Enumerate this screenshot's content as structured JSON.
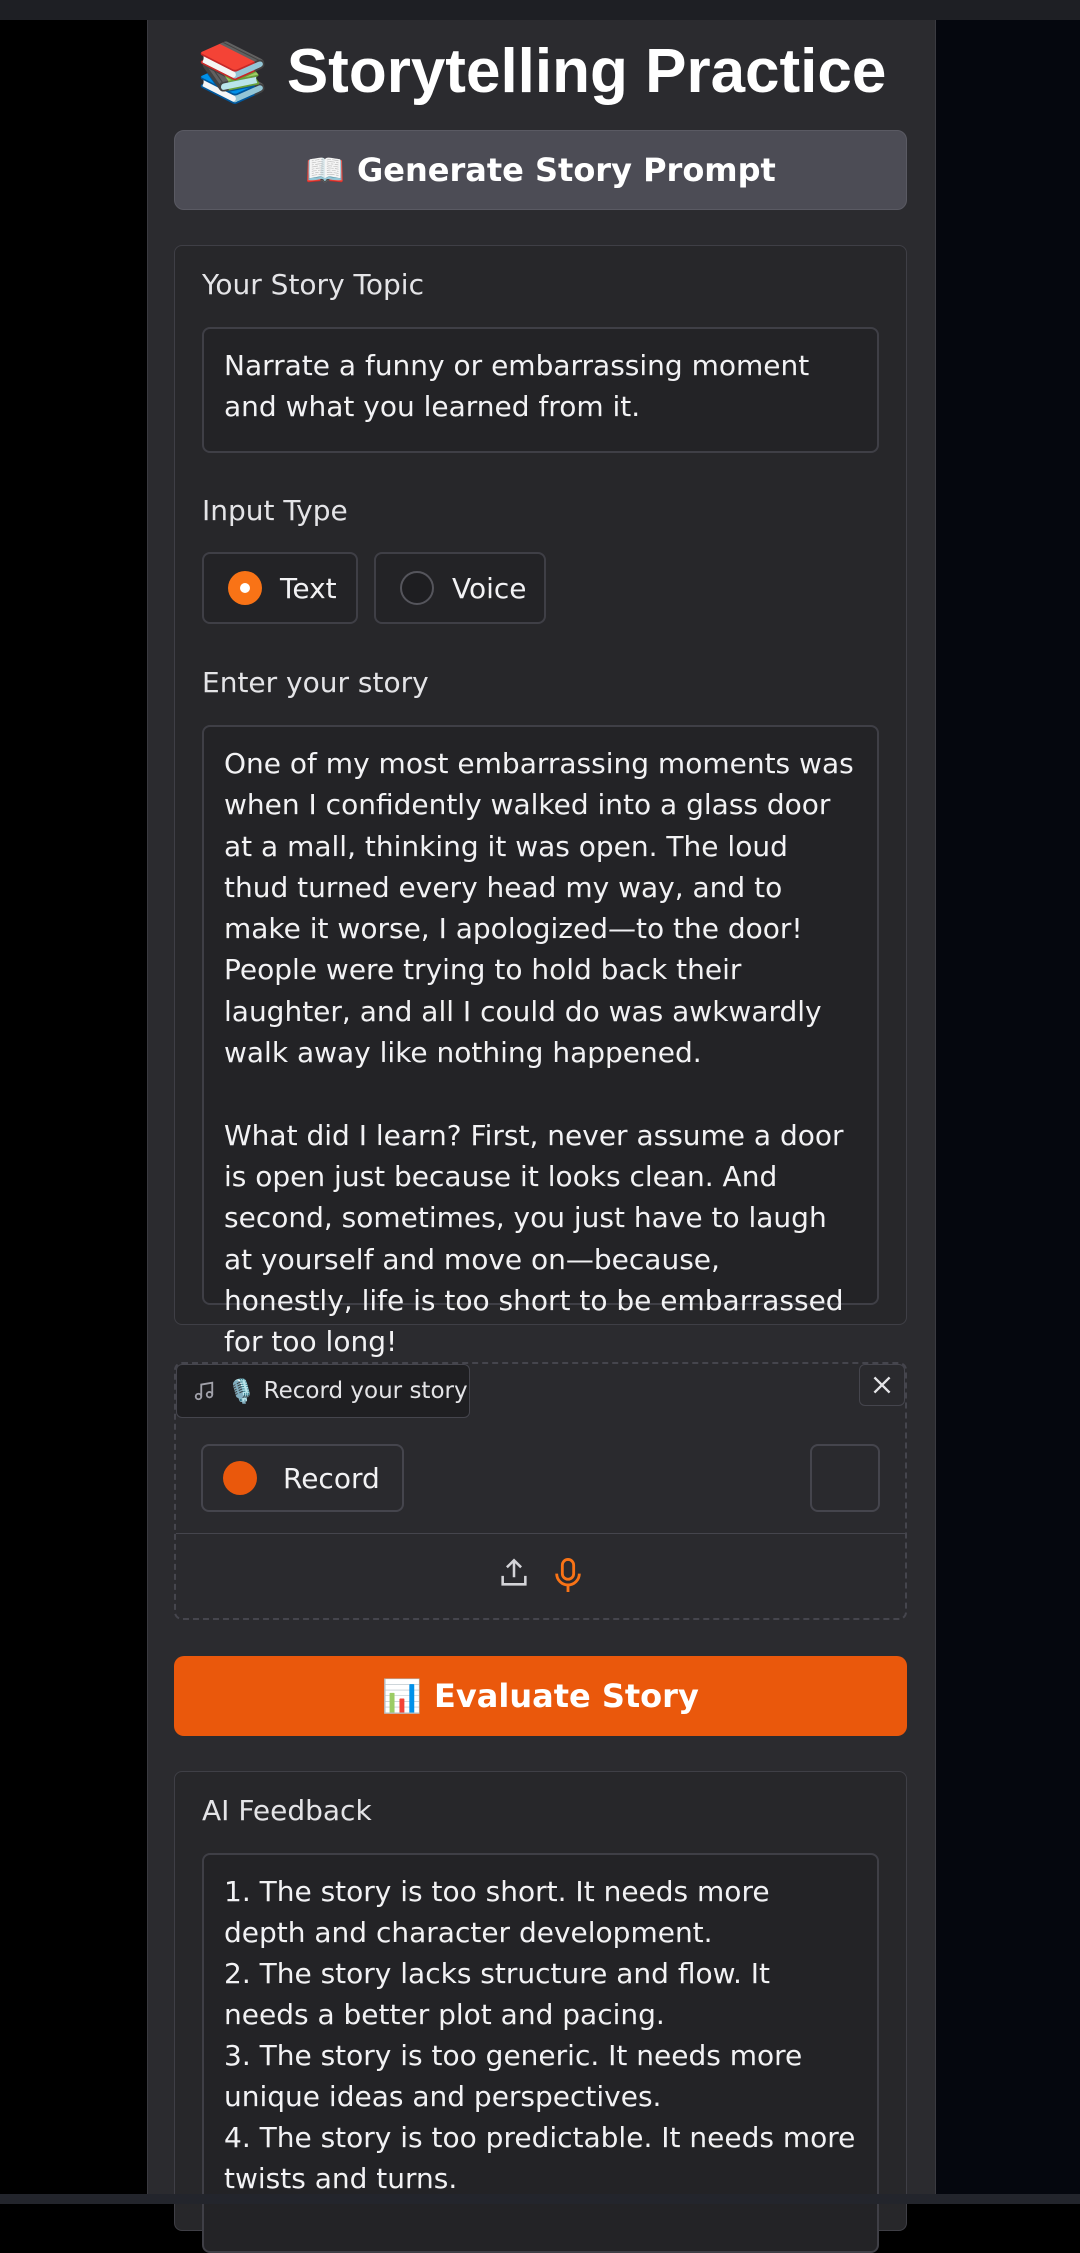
{
  "header": {
    "emoji": "📚",
    "title": "Storytelling Practice"
  },
  "prompt_button": {
    "icon": "📖",
    "label": "Generate Story Prompt"
  },
  "topic": {
    "label": "Your Story Topic",
    "value": "Narrate a funny or embarrassing moment and what you learned from it."
  },
  "input_type": {
    "label": "Input Type",
    "options": [
      {
        "label": "Text",
        "selected": true
      },
      {
        "label": "Voice",
        "selected": false
      }
    ]
  },
  "story": {
    "label": "Enter your story",
    "value": "One of my most embarrassing moments was when I confidently walked into a glass door at a mall, thinking it was open. The loud thud turned every head my way, and to make it worse, I apologized—to the door! People were trying to hold back their laughter, and all I could do was awkwardly walk away like nothing happened.\n\nWhat did I learn? First, never assume a door is open just because it looks clean. And second, sometimes, you just have to laugh at yourself and move on—because, honestly, life is too short to be embarrassed for too long!"
  },
  "audio": {
    "label_emoji": "🎙️",
    "label": "Record your story",
    "record_label": "Record",
    "icons": [
      "music-note-icon",
      "close-icon",
      "upload-icon",
      "microphone-icon"
    ]
  },
  "evaluate_button": {
    "icon": "📊",
    "label": "Evaluate Story"
  },
  "feedback": {
    "label": "AI Feedback",
    "value": "1. The story is too short. It needs more depth and character development.\n2. The story lacks structure and flow. It needs a better plot and pacing.\n3. The story is too generic. It needs more unique ideas and perspectives.\n4. The story is too predictable. It needs more twists and turns."
  },
  "colors": {
    "accent": "#ea580c",
    "panel": "#2b2b2f",
    "background": "#000000"
  }
}
